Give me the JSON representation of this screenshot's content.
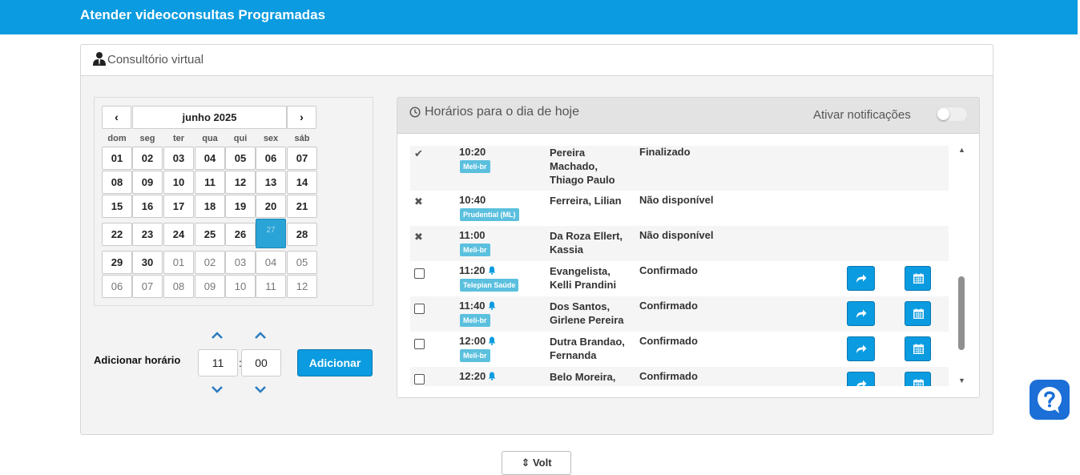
{
  "header": {
    "title": "Atender videoconsultas Programadas"
  },
  "panel": {
    "title": "Consultório virtual"
  },
  "calendar": {
    "month_label": "junho 2025",
    "prev_label": "‹",
    "next_label": "›",
    "weekdays": [
      "dom",
      "seg",
      "ter",
      "qua",
      "qui",
      "sex",
      "sáb"
    ],
    "weeks": [
      [
        {
          "d": "01"
        },
        {
          "d": "02"
        },
        {
          "d": "03"
        },
        {
          "d": "04"
        },
        {
          "d": "05"
        },
        {
          "d": "06"
        },
        {
          "d": "07"
        }
      ],
      [
        {
          "d": "08"
        },
        {
          "d": "09"
        },
        {
          "d": "10"
        },
        {
          "d": "11"
        },
        {
          "d": "12"
        },
        {
          "d": "13"
        },
        {
          "d": "14"
        }
      ],
      [
        {
          "d": "15"
        },
        {
          "d": "16"
        },
        {
          "d": "17"
        },
        {
          "d": "18"
        },
        {
          "d": "19"
        },
        {
          "d": "20"
        },
        {
          "d": "21"
        }
      ],
      [
        {
          "d": "22"
        },
        {
          "d": "23"
        },
        {
          "d": "24"
        },
        {
          "d": "25"
        },
        {
          "d": "26"
        },
        {
          "d": "27",
          "selected": true
        },
        {
          "d": "28"
        }
      ],
      [
        {
          "d": "29"
        },
        {
          "d": "30"
        },
        {
          "d": "01",
          "other": true
        },
        {
          "d": "02",
          "other": true
        },
        {
          "d": "03",
          "other": true
        },
        {
          "d": "04",
          "other": true
        },
        {
          "d": "05",
          "other": true
        }
      ],
      [
        {
          "d": "06",
          "other": true
        },
        {
          "d": "07",
          "other": true
        },
        {
          "d": "08",
          "other": true
        },
        {
          "d": "09",
          "other": true
        },
        {
          "d": "10",
          "other": true
        },
        {
          "d": "11",
          "other": true
        },
        {
          "d": "12",
          "other": true
        }
      ]
    ]
  },
  "add_time": {
    "label": "Adicionar horário",
    "hour": "11",
    "minute": "00",
    "separator": ":",
    "button_label": "Adicionar"
  },
  "schedule": {
    "title": "Horários para o dia de hoje",
    "notifications_label": "Ativar notificações",
    "notifications_on": false,
    "rows": [
      {
        "mark": "check",
        "time": "10:20",
        "bell": false,
        "tag": "Meli-br",
        "name": "Pereira Machado, Thiago Paulo",
        "status": "Finalizado",
        "actions": false
      },
      {
        "mark": "x",
        "time": "10:40",
        "bell": false,
        "tag": "Prudential (ML)",
        "name": "Ferreira, Lilian",
        "status": "Não disponível",
        "actions": false
      },
      {
        "mark": "x",
        "time": "11:00",
        "bell": false,
        "tag": "Meli-br",
        "name": "Da Roza Ellert, Kassia",
        "status": "Não disponível",
        "actions": false
      },
      {
        "mark": "checkbox",
        "time": "11:20",
        "bell": true,
        "tag": "Telepian Saúde",
        "name": "Evangelista, Kelli Prandini",
        "status": "Confirmado",
        "actions": true
      },
      {
        "mark": "checkbox",
        "time": "11:40",
        "bell": true,
        "tag": "Meli-br",
        "name": "Dos Santos, Girlene Pereira",
        "status": "Confirmado",
        "actions": true
      },
      {
        "mark": "checkbox",
        "time": "12:00",
        "bell": true,
        "tag": "Meli-br",
        "name": "Dutra Brandao, Fernanda",
        "status": "Confirmado",
        "actions": true
      },
      {
        "mark": "checkbox",
        "time": "12:20",
        "bell": true,
        "tag": "",
        "name": "Belo Moreira,",
        "status": "Confirmado",
        "actions": true
      }
    ]
  },
  "icons": {
    "user": "user-tie-icon",
    "clock": "clock-icon",
    "bell": "bell-icon",
    "share": "share-arrow-icon",
    "calendar": "calendar-icon",
    "help": "question-icon"
  },
  "colors": {
    "accent": "#0a9be0",
    "tag": "#5bc0de",
    "selected_day": "#2aa4d6",
    "help": "#1b6fd6"
  },
  "bottom_button": {
    "label": "⇕ Volt"
  }
}
